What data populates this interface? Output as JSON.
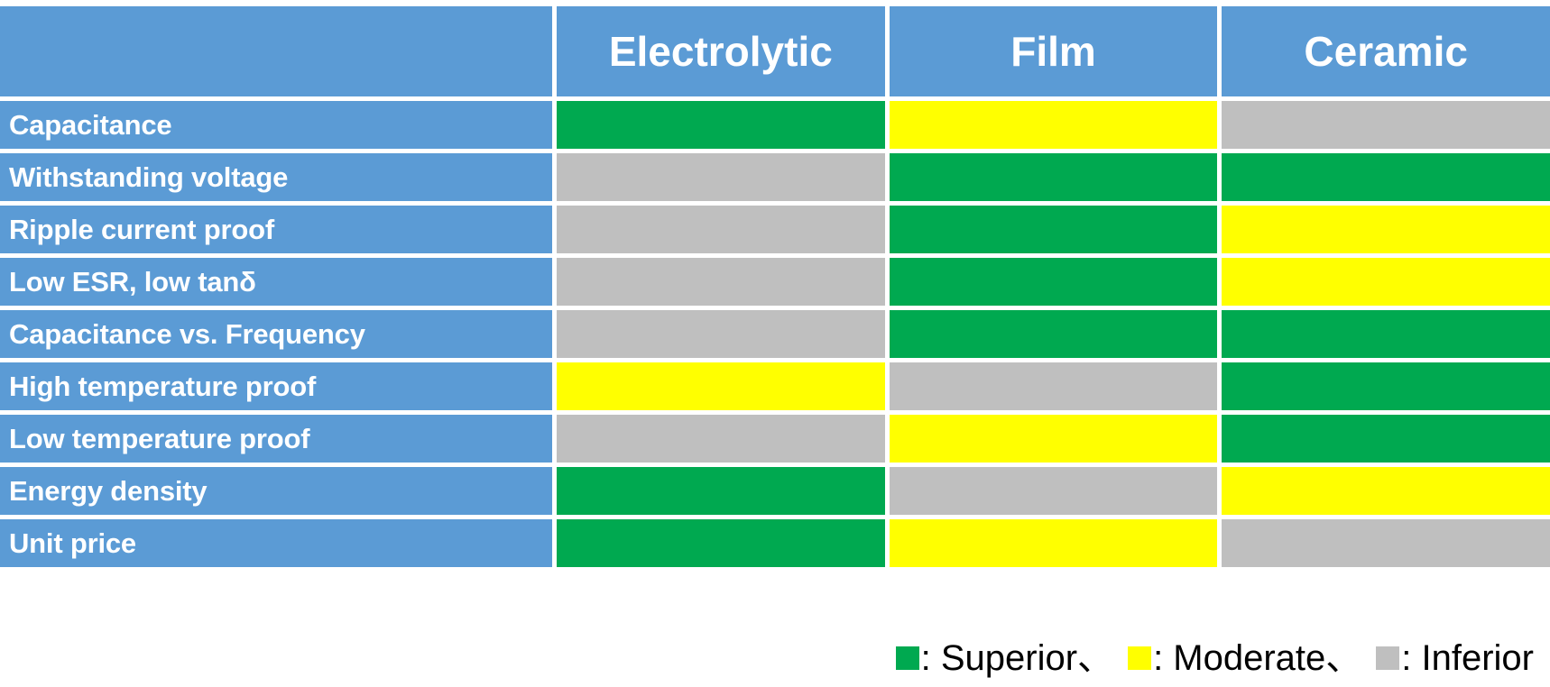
{
  "table": {
    "corner_label": "",
    "columns": [
      "Electrolytic",
      "Film",
      "Ceramic"
    ],
    "rows": [
      {
        "label": "Capacitance",
        "values": [
          "superior",
          "moderate",
          "inferior"
        ]
      },
      {
        "label": "Withstanding voltage",
        "values": [
          "inferior",
          "superior",
          "superior"
        ]
      },
      {
        "label": "Ripple current proof",
        "values": [
          "inferior",
          "superior",
          "moderate"
        ]
      },
      {
        "label": "Low ESR, low tanδ",
        "values": [
          "inferior",
          "superior",
          "moderate"
        ]
      },
      {
        "label": "Capacitance vs. Frequency",
        "values": [
          "inferior",
          "superior",
          "superior"
        ]
      },
      {
        "label": "High temperature proof",
        "values": [
          "moderate",
          "inferior",
          "superior"
        ]
      },
      {
        "label": "Low temperature proof",
        "values": [
          "inferior",
          "moderate",
          "superior"
        ]
      },
      {
        "label": "Energy density",
        "values": [
          "superior",
          "inferior",
          "moderate"
        ]
      },
      {
        "label": "Unit price",
        "values": [
          "superior",
          "moderate",
          "inferior"
        ]
      }
    ]
  },
  "legend": {
    "items": [
      {
        "rating": "superior",
        "text": ": Superior、"
      },
      {
        "rating": "moderate",
        "text": ": Moderate、"
      },
      {
        "rating": "inferior",
        "text": ": Inferior"
      }
    ]
  },
  "colors": {
    "header_blue": "#5B9BD5",
    "superior": "#00A950",
    "moderate": "#FFFF00",
    "inferior": "#BFBFBF",
    "text_white": "#FFFFFF",
    "text_black": "#000000",
    "background": "#FFFFFF"
  }
}
